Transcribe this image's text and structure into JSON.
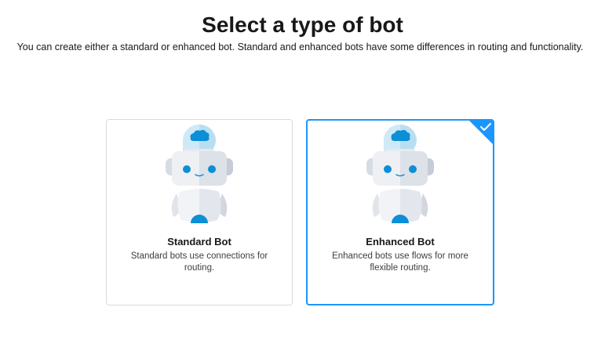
{
  "header": {
    "title": "Select a type of bot",
    "subtitle": "You can create either a standard or enhanced bot. Standard and enhanced bots have some differences in routing and functionality."
  },
  "options": [
    {
      "title": "Standard Bot",
      "description": "Standard bots use connections for routing.",
      "icon": "robot-icon",
      "selected": false
    },
    {
      "title": "Enhanced Bot",
      "description": "Enhanced bots use flows for more flexible routing.",
      "icon": "robot-icon",
      "selected": true
    }
  ],
  "colors": {
    "selected_border": "#1b96ff",
    "card_border": "#dddbda",
    "bot_accent": "#0b8fd6"
  }
}
